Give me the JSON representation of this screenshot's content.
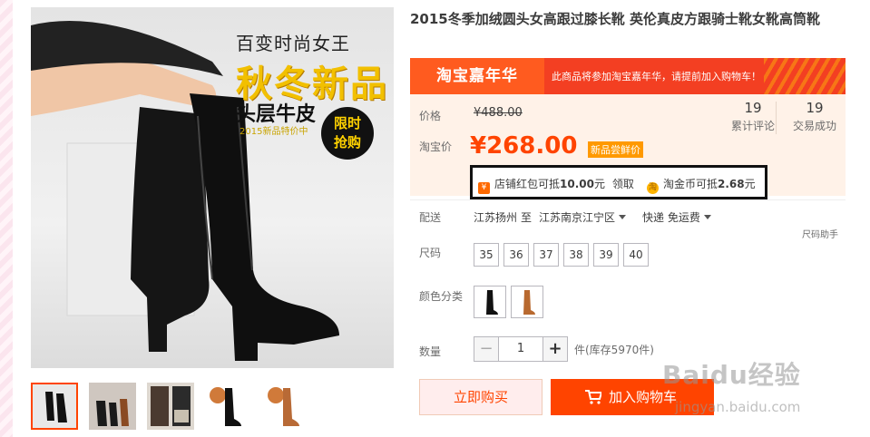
{
  "product": {
    "title": "2015冬季加绒圆头女高跟过膝长靴 英伦真皮方跟骑士靴女靴高筒靴",
    "image_text": {
      "line1": "百变时尚女王",
      "line2": "秋冬新品",
      "line3": "头层牛皮",
      "line4": "2015新品特价中",
      "badge_1": "限时",
      "badge_2": "抢购"
    }
  },
  "banner": {
    "logo": "淘宝嘉年华",
    "message": "此商品将参加淘宝嘉年华，请提前加入购物车！"
  },
  "price": {
    "label_original": "价格",
    "original": "¥488.00",
    "label_taobao": "淘宝价",
    "current": "¥268.00",
    "badge": "新品尝鲜价"
  },
  "stats": [
    {
      "num": "19",
      "label": "累计评论"
    },
    {
      "num": "19",
      "label": "交易成功"
    }
  ],
  "coupons": [
    {
      "prefix": "店铺红包可抵",
      "amount": "10.00",
      "suffix": "元",
      "action": "领取"
    },
    {
      "prefix": "淘金币可抵",
      "amount": "2.68",
      "suffix": "元"
    }
  ],
  "shipping": {
    "label": "配送",
    "from": "江苏扬州",
    "to_word": "至",
    "to": "江苏南京江宁区",
    "method": "快递 免运费"
  },
  "size": {
    "label": "尺码",
    "helper": "尺码助手",
    "options": [
      "35",
      "36",
      "37",
      "38",
      "39",
      "40"
    ]
  },
  "color": {
    "label": "颜色分类",
    "options": [
      "black-boot",
      "brown-boot"
    ]
  },
  "quantity": {
    "label": "数量",
    "value": "1",
    "minus": "−",
    "plus": "+",
    "stock": "件(库存5970件)"
  },
  "actions": {
    "buy": "立即购买",
    "cart": "加入购物车"
  },
  "watermark": {
    "main": "Baidu经验",
    "sub": "jingyan.baidu.com"
  },
  "colors": {
    "accent": "#ff4400",
    "banner": "#f33f22",
    "price_bg": "#fff2e8"
  }
}
